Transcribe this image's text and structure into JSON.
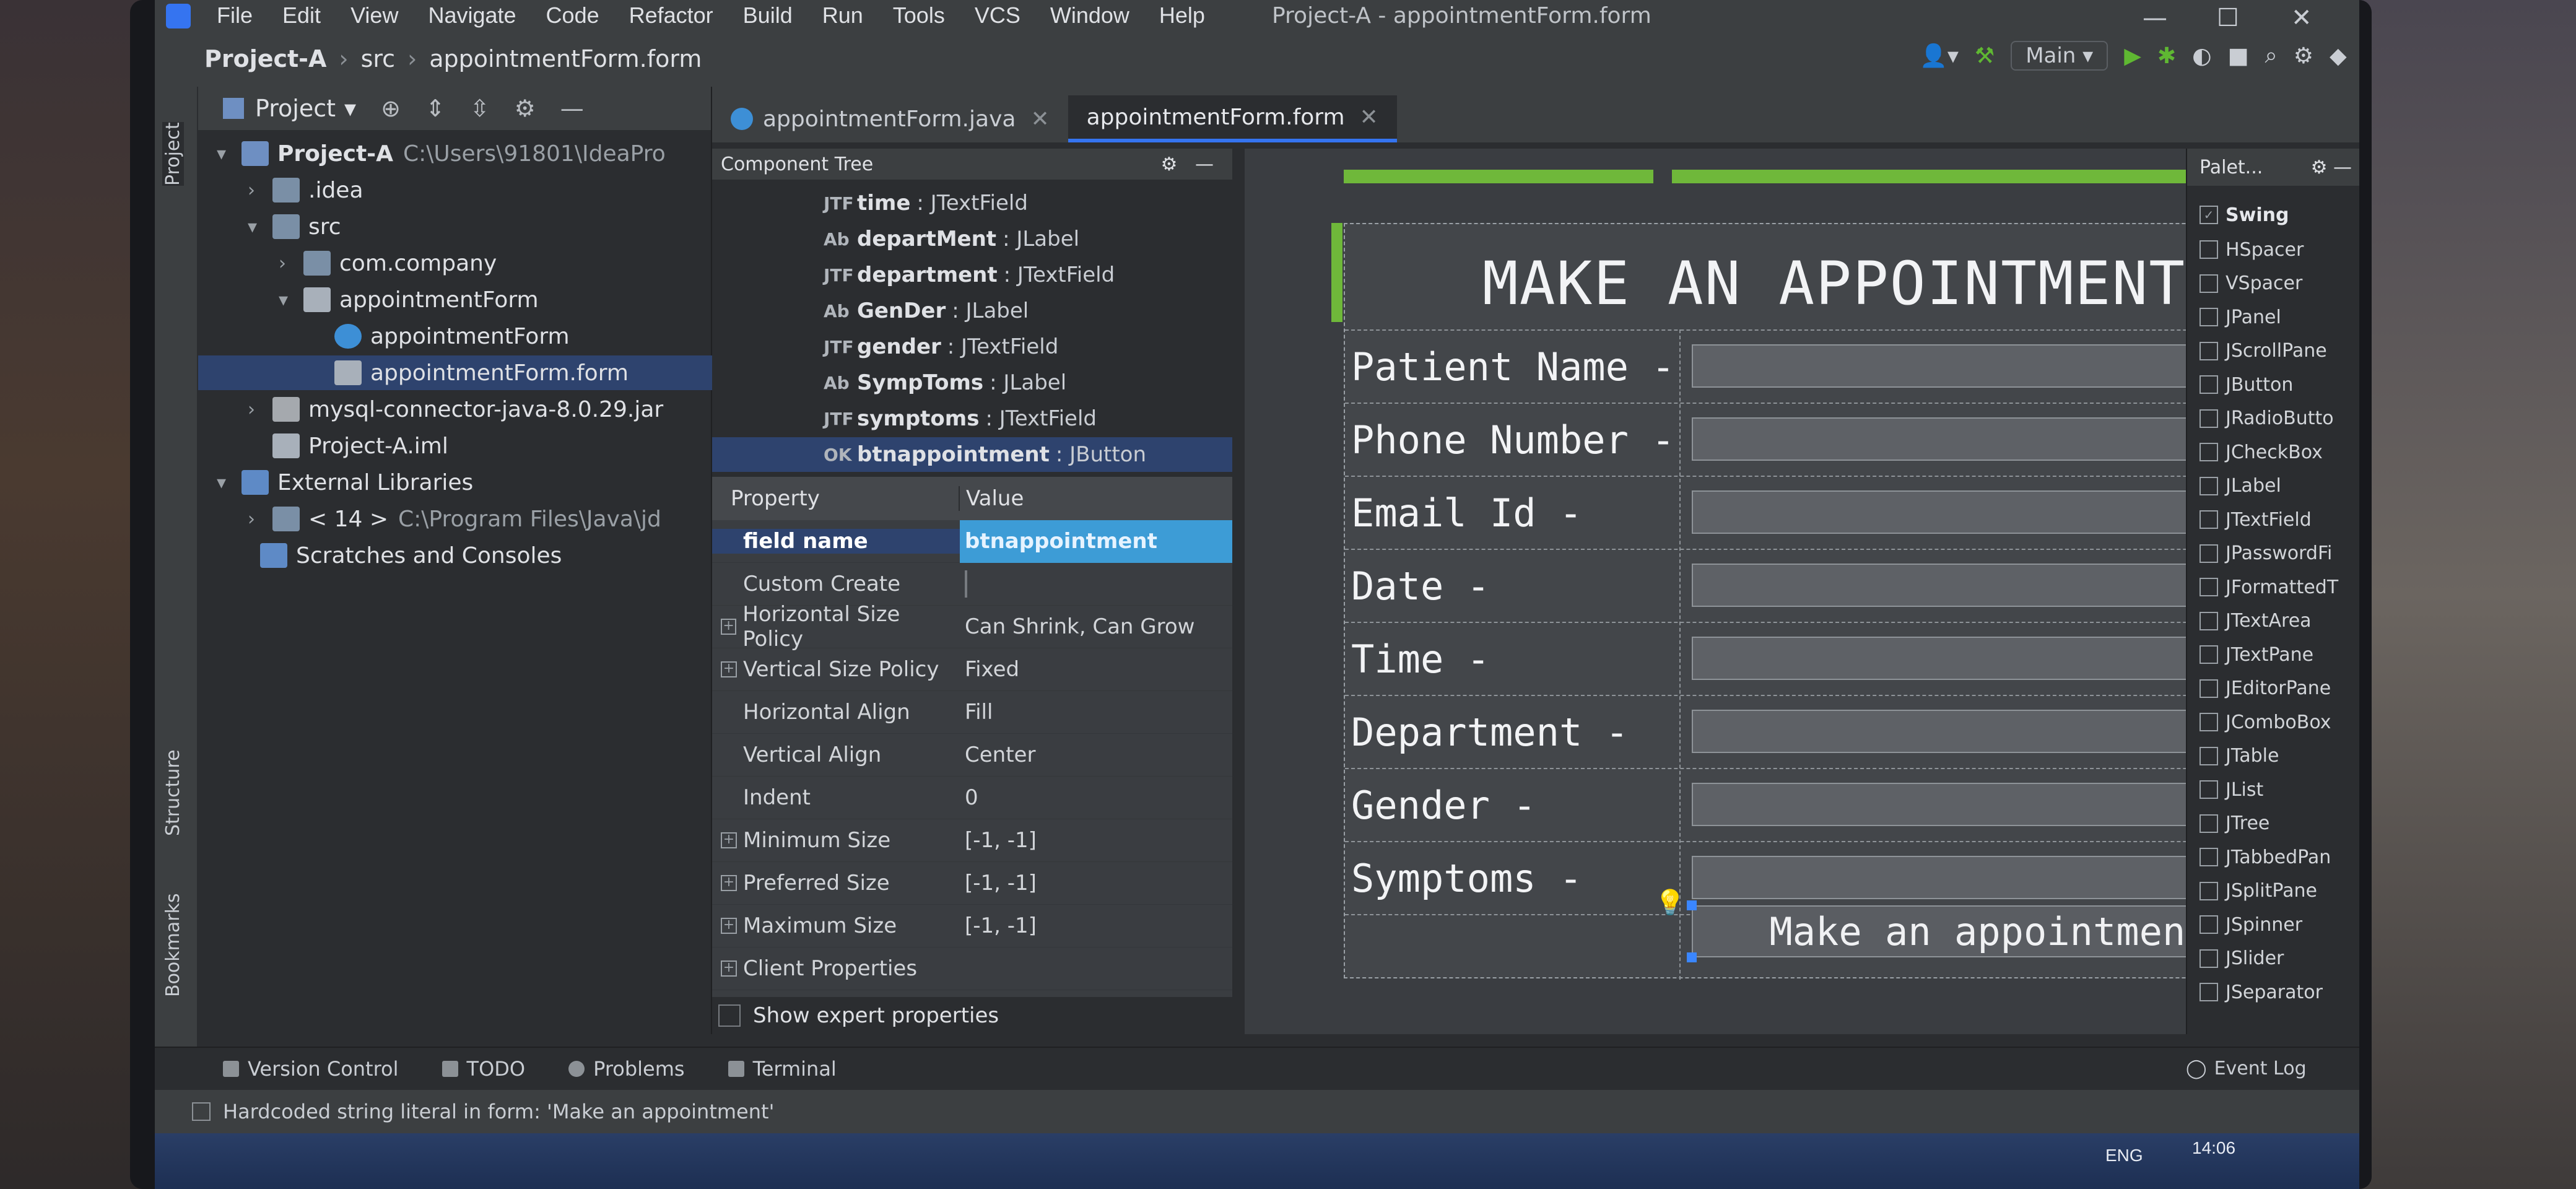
{
  "window": {
    "title": "Project-A - appointmentForm.form",
    "menu": [
      "File",
      "Edit",
      "View",
      "Navigate",
      "Code",
      "Refactor",
      "Build",
      "Run",
      "Tools",
      "VCS",
      "Window",
      "Help"
    ]
  },
  "breadcrumb": [
    "Project-A",
    "src",
    "appointmentForm.form"
  ],
  "toolbar": {
    "run_config": "Main"
  },
  "tool_windows": {
    "project": "Project",
    "structure": "Structure",
    "bookmarks": "Bookmarks"
  },
  "project_panel": {
    "title": "Project",
    "tree": [
      {
        "label": "Project-A",
        "path": "C:\\Users\\91801\\IdeaPro",
        "icon": "module-icon",
        "arrow": "▾"
      },
      {
        "label": ".idea",
        "icon": "folder-icon",
        "arrow": "›"
      },
      {
        "label": "src",
        "icon": "folder-icon",
        "arrow": "▾"
      },
      {
        "label": "com.company",
        "icon": "package-icon",
        "arrow": "›"
      },
      {
        "label": "appointmentForm",
        "icon": "form-icon",
        "arrow": "▾"
      },
      {
        "label": "appointmentForm",
        "icon": "java-class-icon",
        "arrow": ""
      },
      {
        "label": "appointmentForm.form",
        "icon": "form-file-icon",
        "arrow": ""
      },
      {
        "label": "mysql-connector-java-8.0.29.jar",
        "icon": "jar-icon",
        "arrow": "›"
      },
      {
        "label": "Project-A.iml",
        "icon": "iml-icon",
        "arrow": ""
      },
      {
        "label": "External Libraries",
        "icon": "library-icon",
        "arrow": "▾"
      },
      {
        "label": "< 14 >",
        "path": "C:\\Program Files\\Java\\jd",
        "icon": "jdk-icon",
        "arrow": "›"
      },
      {
        "label": "Scratches and Consoles",
        "icon": "scratch-icon",
        "arrow": ""
      }
    ]
  },
  "editor_tabs": [
    {
      "label": "appointmentForm.java",
      "icon": "java-class-icon"
    },
    {
      "label": "appointmentForm.form",
      "icon": "form-file-icon"
    }
  ],
  "component_tree": {
    "title": "Component Tree",
    "rows": [
      {
        "kind": "JTF",
        "name": "time",
        "type": ": JTextField"
      },
      {
        "kind": "Ab",
        "name": "departMent",
        "type": ": JLabel"
      },
      {
        "kind": "JTF",
        "name": "department",
        "type": ": JTextField"
      },
      {
        "kind": "Ab",
        "name": "GenDer",
        "type": ": JLabel"
      },
      {
        "kind": "JTF",
        "name": "gender",
        "type": ": JTextField"
      },
      {
        "kind": "Ab",
        "name": "SympToms",
        "type": ": JLabel"
      },
      {
        "kind": "JTF",
        "name": "symptoms",
        "type": ": JTextField"
      },
      {
        "kind": "OK",
        "name": "btnappointment",
        "type": ": JButton"
      }
    ]
  },
  "properties": {
    "headers": {
      "property": "Property",
      "value": "Value"
    },
    "rows": [
      {
        "name": "field name",
        "value": "btnappointment",
        "expand": false
      },
      {
        "name": "Custom Create",
        "value": "",
        "expand": false,
        "checkbox": true
      },
      {
        "name": "Horizontal Size Policy",
        "value": "Can Shrink, Can Grow",
        "expand": true
      },
      {
        "name": "Vertical Size Policy",
        "value": "Fixed",
        "expand": true
      },
      {
        "name": "Horizontal Align",
        "value": "Fill",
        "expand": false
      },
      {
        "name": "Vertical Align",
        "value": "Center",
        "expand": false
      },
      {
        "name": "Indent",
        "value": "0",
        "expand": false
      },
      {
        "name": "Minimum Size",
        "value": "[-1, -1]",
        "expand": true
      },
      {
        "name": "Preferred Size",
        "value": "[-1, -1]",
        "expand": true
      },
      {
        "name": "Maximum Size",
        "value": "[-1, -1]",
        "expand": true
      },
      {
        "name": "Client Properties",
        "value": "",
        "expand": true
      }
    ],
    "show_expert": "Show expert properties"
  },
  "form": {
    "title": "MAKE AN APPOINTMENT",
    "fields": [
      "Patient Name -",
      "Phone Number -",
      "Email Id -",
      "Date -",
      "Time -",
      "Department -",
      "Gender -",
      "Symptoms -"
    ],
    "button": "Make an appointment"
  },
  "palette": {
    "title": "Palet...",
    "group": "Swing",
    "items": [
      "HSpacer",
      "VSpacer",
      "JPanel",
      "JScrollPane",
      "JButton",
      "JRadioButto",
      "JCheckBox",
      "JLabel",
      "JTextField",
      "JPasswordFi",
      "JFormattedT",
      "JTextArea",
      "JTextPane",
      "JEditorPane",
      "JComboBox",
      "JTable",
      "JList",
      "JTree",
      "JTabbedPan",
      "JSplitPane",
      "JSpinner",
      "JSlider",
      "JSeparator"
    ]
  },
  "bottom_tools": [
    "Version Control",
    "TODO",
    "Problems",
    "Terminal"
  ],
  "event_log": "Event Log",
  "status_message": "Hardcoded string literal in form: 'Make an appointment'",
  "taskbar": {
    "lang": "ENG",
    "time": "14:06"
  }
}
